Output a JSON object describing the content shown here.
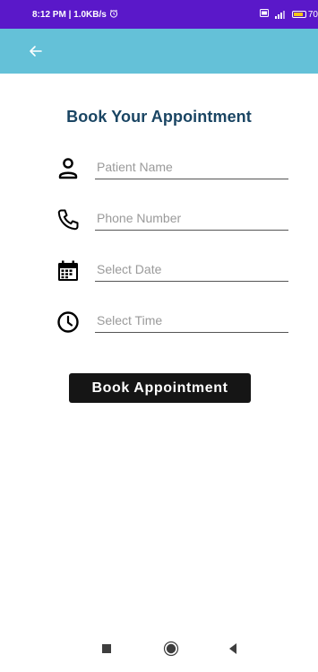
{
  "status_bar": {
    "time_speed": "8:12 PM | 1.0KB/s",
    "battery": "70"
  },
  "app_bar": {
    "background": "#64c1d8"
  },
  "title": "Book Your Appointment",
  "form": {
    "patient_name": {
      "placeholder": "Patient Name",
      "value": ""
    },
    "phone_number": {
      "placeholder": "Phone Number",
      "value": ""
    },
    "date": {
      "placeholder": "Select Date",
      "value": ""
    },
    "time": {
      "placeholder": "Select Time",
      "value": ""
    }
  },
  "book_button": "Book Appointment",
  "icons": {
    "back": "arrow-left-icon",
    "person": "person-icon",
    "phone": "phone-icon",
    "calendar": "calendar-icon",
    "clock": "clock-icon"
  },
  "colors": {
    "status_bar": "#5a18c9",
    "title": "#1a4563",
    "button": "#151515"
  }
}
